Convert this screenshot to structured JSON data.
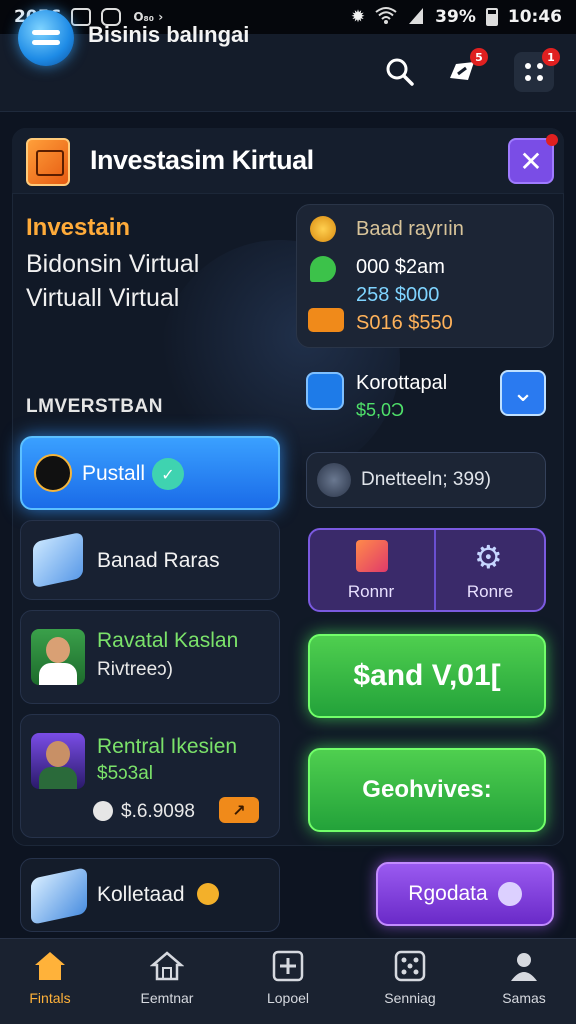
{
  "status_bar": {
    "time": "2056",
    "carrier": "O₈₀ ›",
    "battery": "39%",
    "clock_right": "10:46"
  },
  "app": {
    "title": "Bisinis balıngai",
    "notification_count": "5",
    "menu_count": "1"
  },
  "main": {
    "title": "Investasim Kirtual",
    "hero": {
      "accent": "Investain",
      "line1": "Bidonsin Virtual",
      "line2": "Virtuall Virtual"
    },
    "section_label": "LMVERSTBAN"
  },
  "left_list": [
    {
      "label": "Pustall",
      "active": true
    },
    {
      "label": "Banad Raras"
    },
    {
      "title": "Ravatal Kaslan",
      "subtitle": "Rivtreeɔ)"
    },
    {
      "title": "Rentral Ikesien",
      "value": "$5ɔ3al",
      "amount": "$.6.9098"
    }
  ],
  "bottom_item": {
    "label": "Kolletaad"
  },
  "stats_card": {
    "title": "Baad rayrıin",
    "row1": "000 $2am",
    "row2": "258 $000",
    "row3": "S016 $550"
  },
  "kontrol": {
    "title": "Korottapal",
    "value": "$5,0Ɔ"
  },
  "search_field": {
    "text": "Dnetteeln; 399)"
  },
  "tile_buttons": [
    {
      "label": "Ronnr"
    },
    {
      "label": "Ronre"
    }
  ],
  "green_buttons": {
    "primary": "$and V,01[",
    "secondary": "Geohvives:"
  },
  "purple_button": {
    "label": "Rgodata"
  },
  "bottom_nav": [
    {
      "label": "Fintals",
      "icon": "home-filled-icon"
    },
    {
      "label": "Eemtnar",
      "icon": "home-outline-icon"
    },
    {
      "label": "Lopoel",
      "icon": "plus-square-icon"
    },
    {
      "label": "Senniag",
      "icon": "dice-icon"
    },
    {
      "label": "Samas",
      "icon": "person-icon"
    }
  ],
  "colors": {
    "accent_blue": "#2a8cf5",
    "accent_green": "#3cc24a",
    "accent_purple": "#8a4de0",
    "accent_orange": "#ff9f3a"
  }
}
